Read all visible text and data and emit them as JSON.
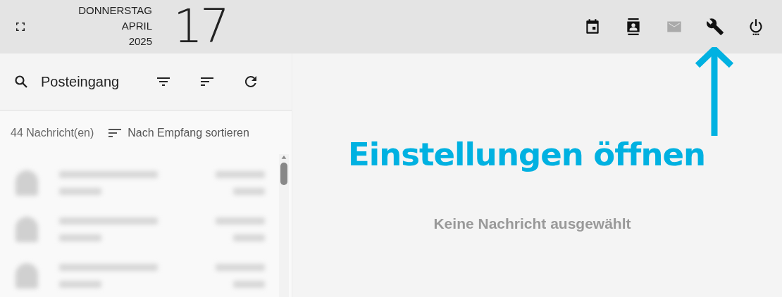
{
  "header": {
    "weekday": "DONNERSTAG",
    "month": "APRIL",
    "year": "2025",
    "day": "17"
  },
  "toolbar": [
    {
      "kind": "calendar",
      "disabled": false
    },
    {
      "kind": "contacts",
      "disabled": false
    },
    {
      "kind": "mail",
      "disabled": true
    },
    {
      "kind": "wrench",
      "disabled": false
    },
    {
      "kind": "power",
      "disabled": false
    }
  ],
  "mail_panel": {
    "folder": "Posteingang",
    "count": "44 Nachricht(en)",
    "sort": "Nach Empfang sortieren",
    "messages": [
      {
        "kind": "blurred"
      },
      {
        "kind": "blurred"
      },
      {
        "kind": "blurred"
      }
    ]
  },
  "reading_pane": {
    "empty_text": "Keine Nachricht ausgewählt"
  },
  "annotation": {
    "text": "Einstellungen öffnen"
  }
}
